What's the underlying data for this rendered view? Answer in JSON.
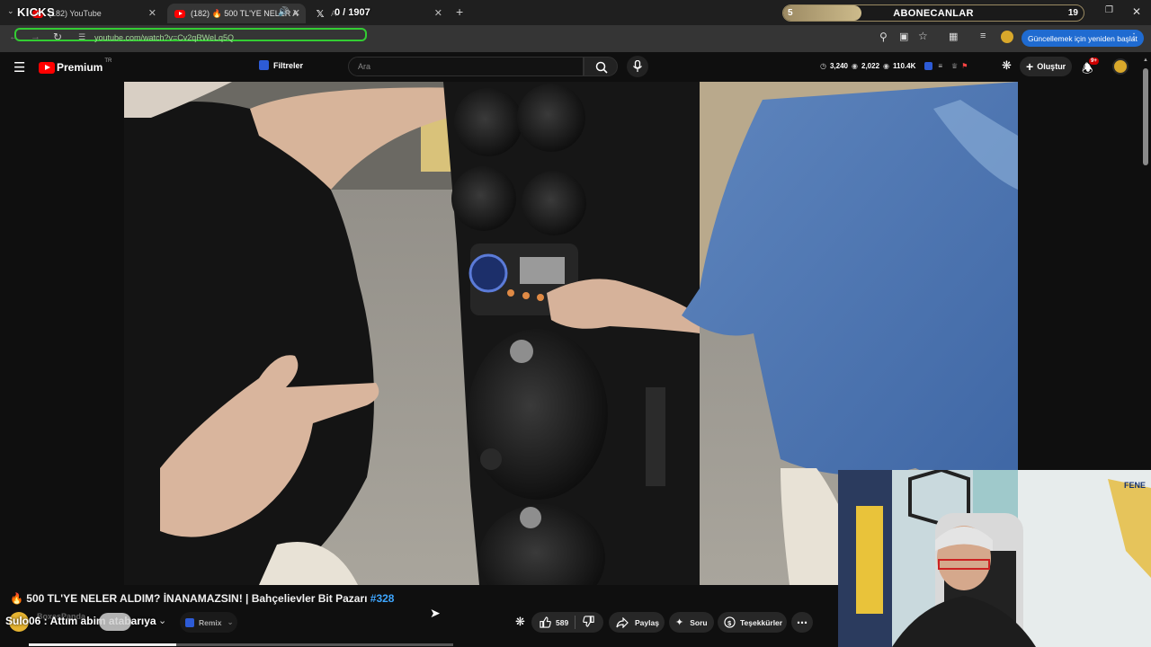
{
  "browser": {
    "tabs": [
      {
        "label": "(182) YouTube",
        "active": false
      },
      {
        "label": "(182) 🔥 500 TL'YE NELER A",
        "active": true
      },
      {
        "label": "A",
        "active": false
      }
    ],
    "new_tab_icon": "plus-icon",
    "url": "youtube.com/watch?v=Cv2qRWeLq5Q",
    "update_button": "Güncellemek için yeniden başlat"
  },
  "overlay": {
    "kicks": "KICKS",
    "count": "0 / 1907",
    "subscriber_goal": {
      "left": "5",
      "title": "ABONECANLAR",
      "right": "19",
      "progress": 0.26
    }
  },
  "youtube": {
    "logo_label": "Premium",
    "country": "TR",
    "filter_label": "Filtreler",
    "search_placeholder": "Ara",
    "stats": {
      "views_a": "3,240",
      "views_b": "2,022",
      "views_c": "110.4K"
    },
    "create_label": "Oluştur",
    "notification_badge": "9+"
  },
  "video": {
    "title_prefix": "🔥 500 TL'YE NELER ALDIM? İNANAMAZSIN! | Bahçelievler Bit Pazarı ",
    "title_tag": "#328",
    "channel": "BoxesPanda",
    "remix_label": "Remix",
    "likes": "589",
    "share_label": "Paylaş",
    "ask_label": "Soru",
    "thanks_label": "Teşekkürler"
  },
  "stream_caption": "Sulo06 : Attım abim atabarıya",
  "webcam_pennant": "FENE"
}
